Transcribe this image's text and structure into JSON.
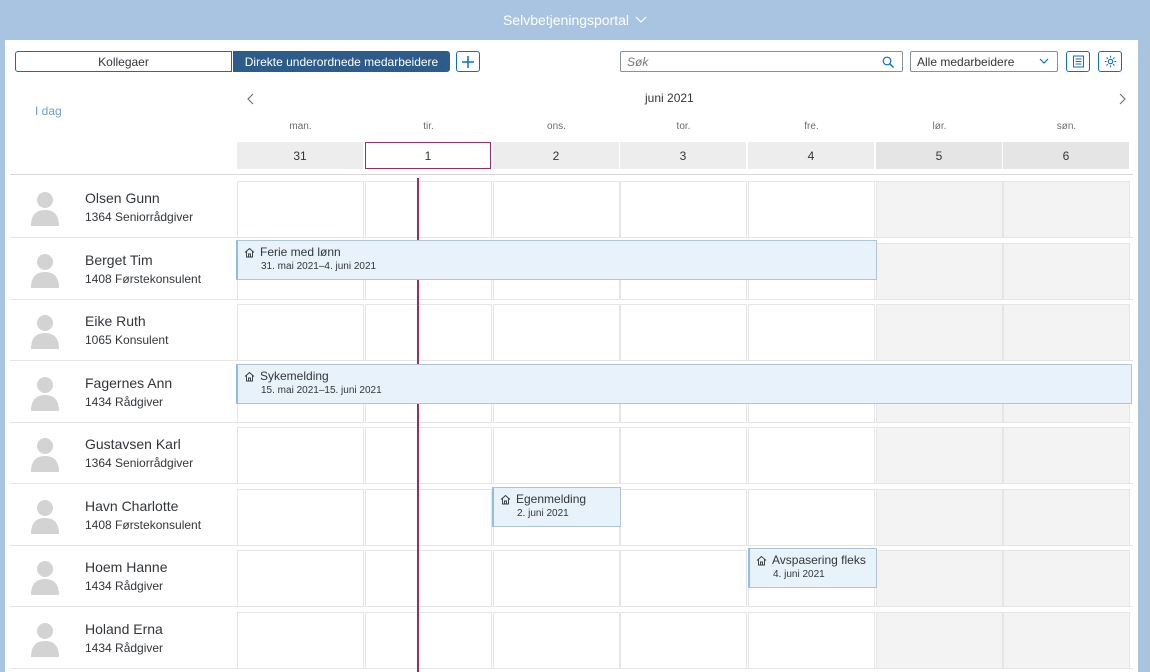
{
  "shell": {
    "title": "Selvbetjeningsportal"
  },
  "toolbar": {
    "tab_colleagues": "Kollegaer",
    "tab_direct_reports": "Direkte underordnede medarbeidere",
    "search_placeholder": "Søk",
    "filter_value": "Alle medarbeidere"
  },
  "calendar": {
    "today_label": "I dag",
    "month_label": "juni 2021",
    "day_names": [
      "man.",
      "tir.",
      "ons.",
      "tor.",
      "fre.",
      "lør.",
      "søn."
    ],
    "day_numbers": [
      "31",
      "1",
      "2",
      "3",
      "4",
      "5",
      "6"
    ]
  },
  "employees": [
    {
      "name": "Olsen Gunn",
      "role": "1364 Seniorrådgiver"
    },
    {
      "name": "Berget Tim",
      "role": "1408 Førstekonsulent"
    },
    {
      "name": "Eike Ruth",
      "role": "1065 Konsulent"
    },
    {
      "name": "Fagernes Ann",
      "role": "1434 Rådgiver"
    },
    {
      "name": "Gustavsen Karl",
      "role": "1364 Seniorrådgiver"
    },
    {
      "name": "Havn Charlotte",
      "role": "1408 Førstekonsulent"
    },
    {
      "name": "Hoem Hanne",
      "role": "1434 Rådgiver"
    },
    {
      "name": "Holand Erna",
      "role": "1434 Rådgiver"
    }
  ],
  "appointments": [
    {
      "title": "Ferie med lønn",
      "dates": "31. mai 2021–4. juni 2021",
      "icon": "home-icon"
    },
    {
      "title": "Sykemelding",
      "dates": "15. mai 2021–15. juni 2021",
      "icon": "home-icon"
    },
    {
      "title": "Egenmelding",
      "dates": "2. juni 2021",
      "icon": "home-icon"
    },
    {
      "title": "Avspasering fleks",
      "dates": "4. juni 2021",
      "icon": "home-icon"
    }
  ],
  "colors": {
    "accent": "#0a6ed1",
    "today_line": "#a0296a",
    "shell": "#a9c4e0",
    "appointment_bg": "#e8f2fb"
  }
}
